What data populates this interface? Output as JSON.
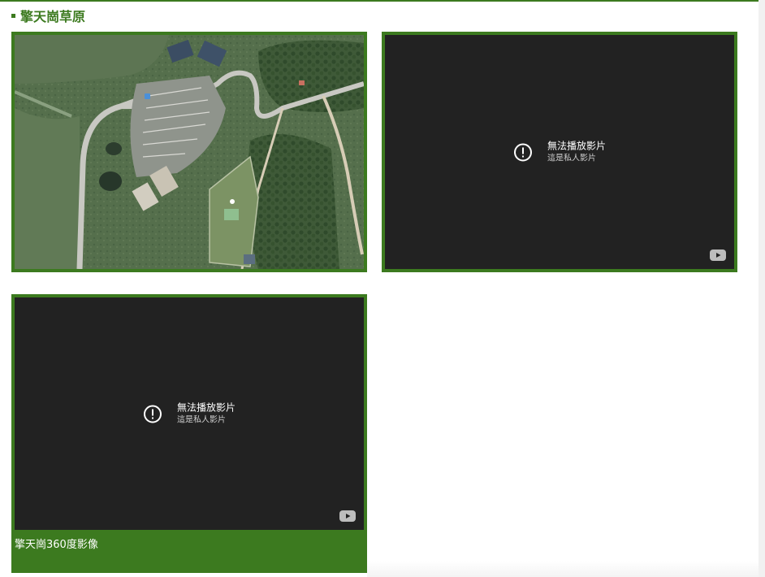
{
  "section": {
    "title": "擎天崗草原"
  },
  "map": {
    "icon": "map-satellite-view"
  },
  "videos": [
    {
      "error_title": "無法播放影片",
      "error_subtitle": "這是私人影片"
    },
    {
      "error_title": "無法播放影片",
      "error_subtitle": "這是私人影片",
      "caption": "擎天崗360度影像"
    }
  ],
  "colors": {
    "accent": "#3c7a1f",
    "player_bg": "#222222"
  }
}
